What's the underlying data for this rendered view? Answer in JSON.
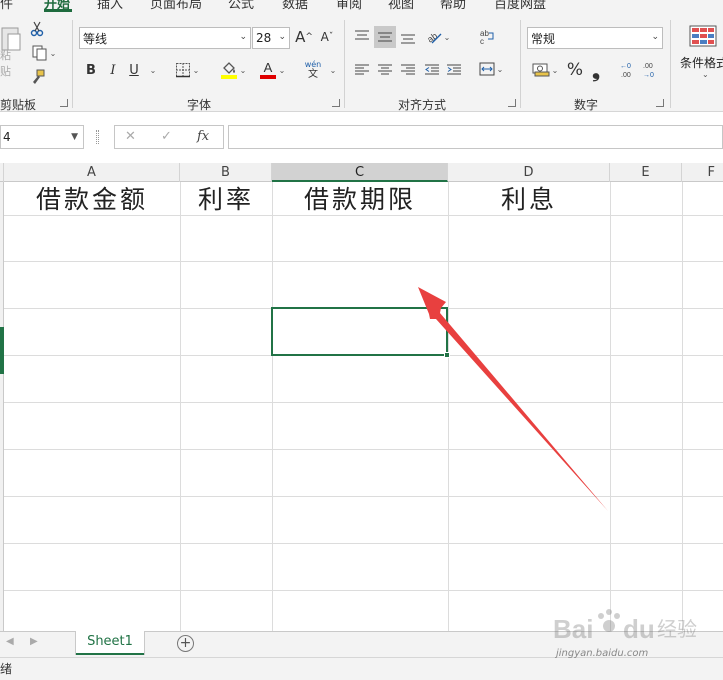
{
  "ribbon": {
    "tabs": [
      {
        "label": "件"
      },
      {
        "label": "开始",
        "active": true
      },
      {
        "label": "插入"
      },
      {
        "label": "页面布局"
      },
      {
        "label": "公式"
      },
      {
        "label": "数据"
      },
      {
        "label": "审阅"
      },
      {
        "label": "视图"
      },
      {
        "label": "帮助"
      },
      {
        "label": "百度网盘"
      }
    ],
    "clipboard": {
      "group_label": "剪贴板",
      "paste_label": "粘贴"
    },
    "font": {
      "group_label": "字体",
      "font_name": "等线",
      "font_size": "28",
      "grow_label": "A",
      "shrink_label": "A",
      "bold": "B",
      "italic": "I",
      "underline": "U",
      "highlight_color": "#ffff00",
      "font_color": "#e00000",
      "phonetic_top": "wén",
      "phonetic_bottom": "文"
    },
    "alignment": {
      "group_label": "对齐方式"
    },
    "number": {
      "group_label": "数字",
      "format": "常规",
      "percent": "%",
      "comma": "❟"
    },
    "styles": {
      "conditional_label": "条件格式"
    }
  },
  "formula_bar": {
    "name_box_value": "4",
    "cancel": "✕",
    "enter": "✓",
    "fx": "fx",
    "formula": ""
  },
  "sheet": {
    "columns": [
      "A",
      "B",
      "C",
      "D",
      "E",
      "F"
    ],
    "selected_column": "C",
    "headers_row": [
      "借款金额",
      "利率",
      "借款期限",
      "利息"
    ],
    "active_cell": "C"
  },
  "sheet_tabs": {
    "active": "Sheet1",
    "add": "+"
  },
  "status": {
    "text": "绪"
  },
  "watermark": {
    "brand": "Baidu",
    "brand_cn": "经验",
    "url": "jingyan.baidu.com"
  },
  "colors": {
    "accent": "#217346",
    "annotation_arrow": "#e8403f"
  }
}
